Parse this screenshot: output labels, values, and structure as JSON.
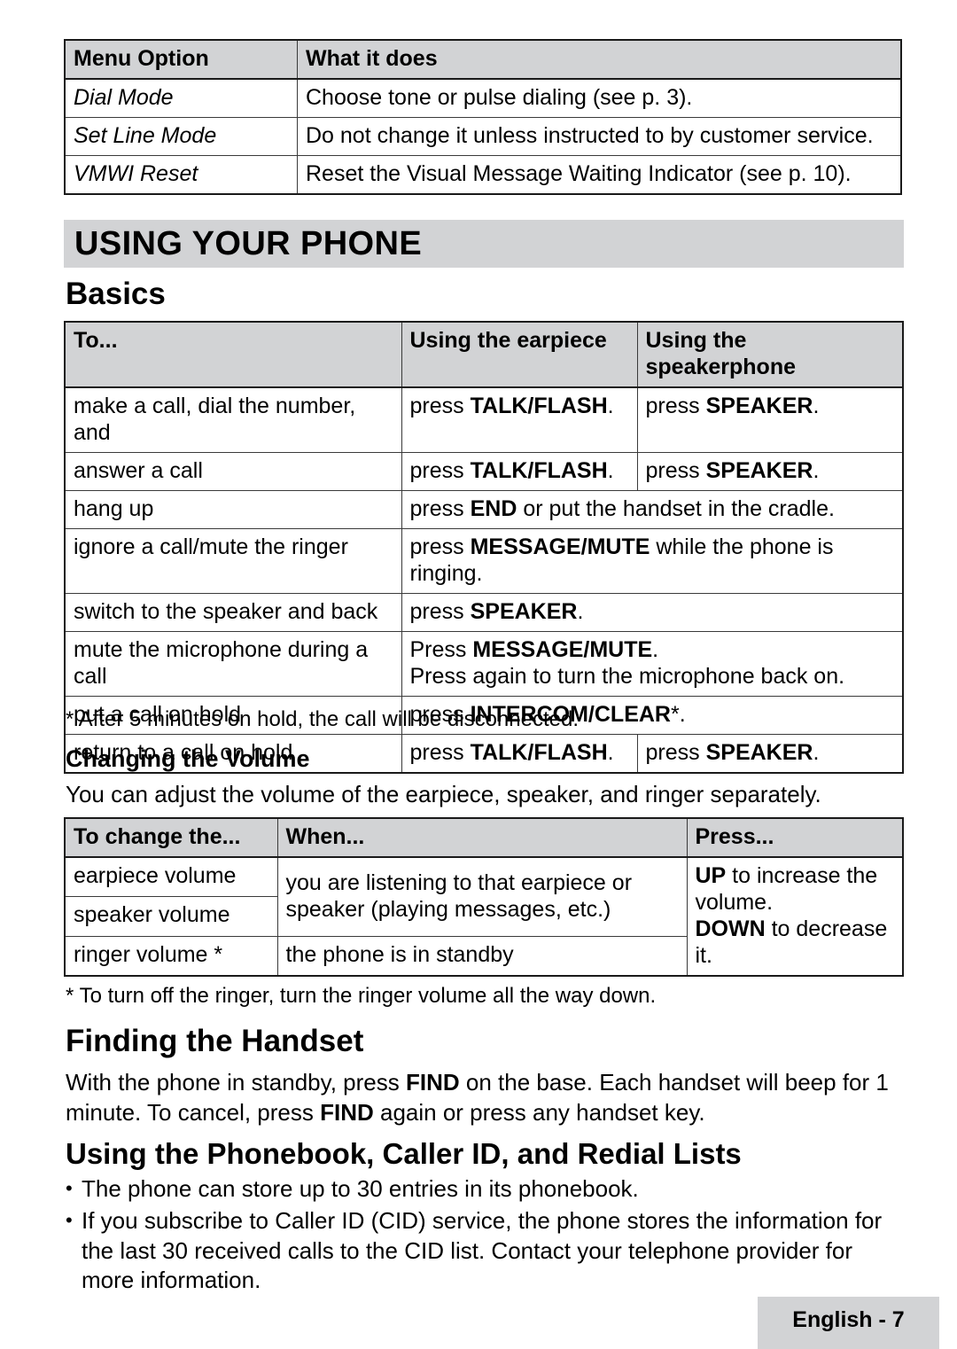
{
  "menu_table": {
    "headers": [
      "Menu Option",
      "What it does"
    ],
    "rows": [
      {
        "option": "Dial Mode",
        "description": "Choose tone or pulse dialing (see p. 3)."
      },
      {
        "option": "Set Line Mode",
        "description": "Do not change it unless instructed to by customer service."
      },
      {
        "option": "VMWI Reset",
        "description": "Reset the Visual Message Waiting Indicator (see p. 10)."
      }
    ]
  },
  "section": {
    "banner_title": "USING YOUR PHONE",
    "basics_heading": "Basics",
    "volume_heading": "Changing the Volume",
    "finding_heading": "Finding the Handset",
    "phonebook_heading": "Using the Phonebook, Caller ID, and Redial Lists"
  },
  "basics_table": {
    "headers": [
      "To...",
      "Using the earpiece",
      "Using the speakerphone"
    ],
    "rows": [
      {
        "to": "make a call, dial the number, and",
        "earpiece_plain": "press ",
        "earpiece_bold": "TALK/FLASH",
        "earpiece_tail": ".",
        "speaker_plain": "press ",
        "speaker_bold": "SPEAKER",
        "speaker_tail": "."
      },
      {
        "to": "answer a call",
        "earpiece_plain": "press ",
        "earpiece_bold": "TALK/FLASH",
        "earpiece_tail": ".",
        "speaker_plain": "press ",
        "speaker_bold": "SPEAKER",
        "speaker_tail": "."
      },
      {
        "to": "hang up",
        "span_plain": "press ",
        "span_bold": "END",
        "span_tail": " or put the handset in the cradle."
      },
      {
        "to": "ignore a call/mute the ringer",
        "span_plain": "press ",
        "span_bold": "MESSAGE/MUTE",
        "span_tail": " while the phone is ringing."
      },
      {
        "to": "switch to the speaker and back",
        "span_plain": "press ",
        "span_bold": "SPEAKER",
        "span_tail": "."
      },
      {
        "to": "mute the microphone during a call",
        "span_plain": "Press ",
        "span_bold": "MESSAGE/MUTE",
        "span_tail": ".",
        "span_line2": "Press again to turn the microphone back on."
      },
      {
        "to": "put a call on hold",
        "span_plain": "press ",
        "span_bold": "INTERCOM/CLEAR",
        "span_tail": "*."
      },
      {
        "to": "return to a call on hold",
        "earpiece_plain": "press ",
        "earpiece_bold": "TALK/FLASH",
        "earpiece_tail": ".",
        "speaker_plain": "press ",
        "speaker_bold": "SPEAKER",
        "speaker_tail": "."
      }
    ],
    "footnote": "* After 5 minutes on hold, the call will be disconnected."
  },
  "volume": {
    "intro": "You can adjust the volume of the earpiece, speaker, and ringer separately.",
    "headers": [
      "To change the...",
      "When...",
      "Press..."
    ],
    "row1_label": "earpiece volume",
    "row2_label": "speaker volume",
    "row3_label": "ringer volume *",
    "when_merged": "you are listening to that earpiece or speaker (playing messages, etc.)",
    "when_standby": "the phone is in standby",
    "press_up_bold": "UP",
    "press_up_tail": " to increase the volume.",
    "press_down_bold": "DOWN",
    "press_down_tail": " to decrease it.",
    "footnote": "* To turn off the ringer, turn the ringer volume all the way down."
  },
  "finding": {
    "body_part1": "With the phone in standby, press ",
    "body_bold1": "FIND",
    "body_part2": " on the base. Each handset will beep for 1 minute. To cancel, press ",
    "body_bold2": "FIND",
    "body_part3": " again or press any handset key."
  },
  "phonebook": {
    "bullets": [
      "The phone can store up to 30 entries in its phonebook.",
      "If you subscribe to Caller ID (CID) service, the phone stores the information for the last 30 received calls to the CID list. Contact your telephone provider for more information."
    ]
  },
  "footer": {
    "label": "English - 7"
  },
  "colors": {
    "header_gray": "#d2d3d5",
    "border_dark": "#1a1a1a",
    "text": "#000000"
  }
}
